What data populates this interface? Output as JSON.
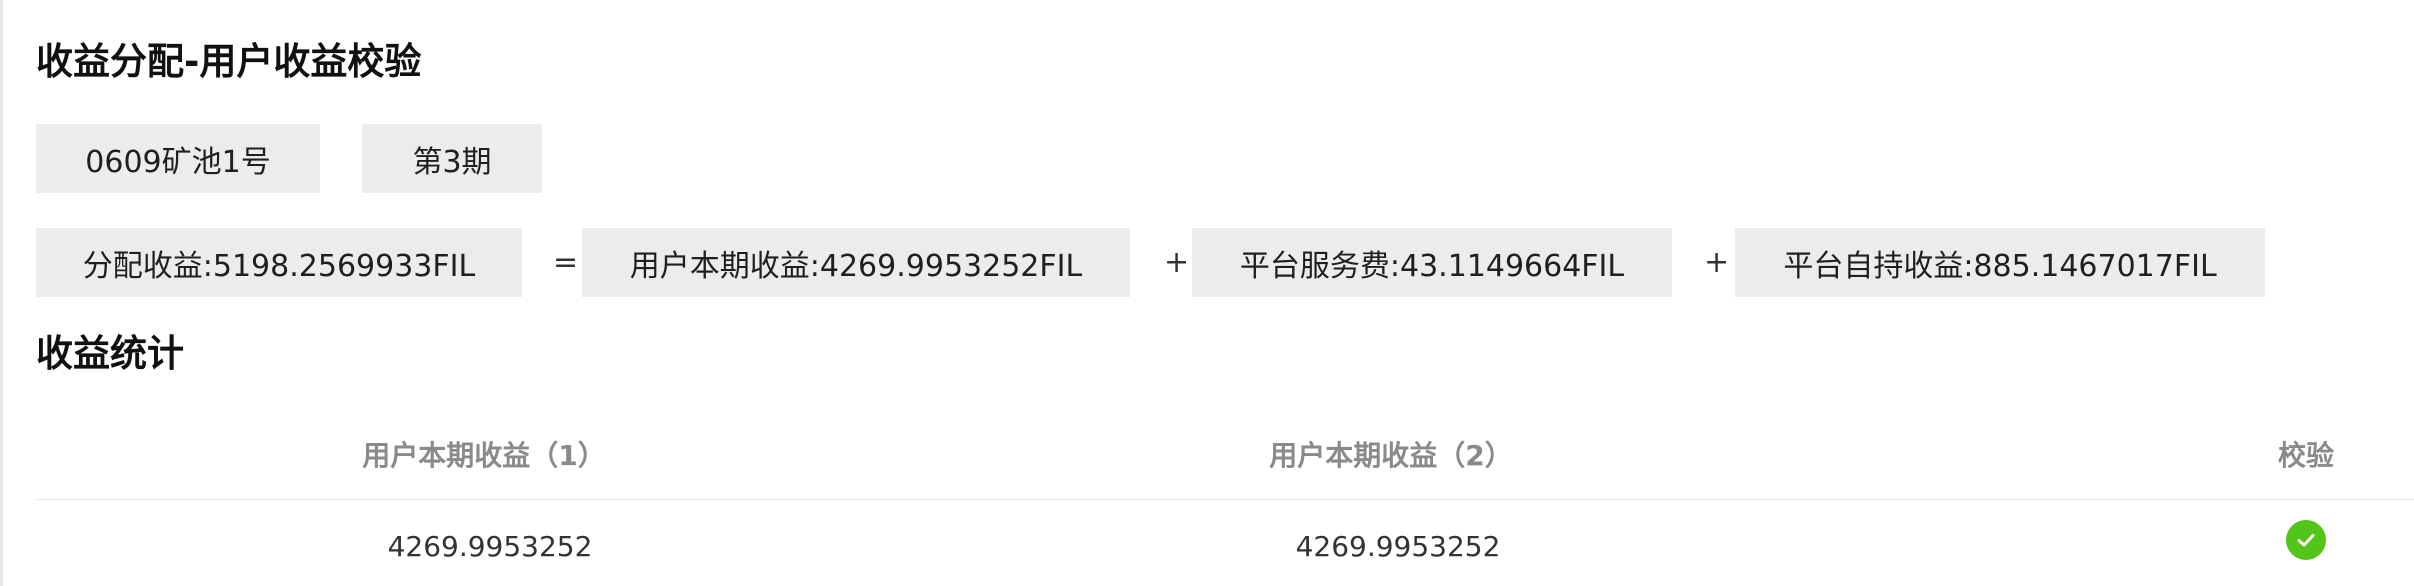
{
  "page_title": "收益分配-用户收益校验",
  "pool_chip": "0609矿池1号",
  "period_chip": "第3期",
  "formula": {
    "total": "分配收益:5198.2569933FIL",
    "equals": "=",
    "user_income": "用户本期收益:4269.9953252FIL",
    "plus_1": "+",
    "service_fee": "平台服务费:43.1149664FIL",
    "plus_2": "+",
    "self_held": "平台自持收益:885.1467017FIL"
  },
  "stats_title": "收益统计",
  "table": {
    "columns": [
      "用户本期收益（1）",
      "用户本期收益（2）",
      "校验"
    ],
    "rows": [
      {
        "income_1": "4269.9953252",
        "income_2": "4269.9953252",
        "verified": true
      }
    ]
  },
  "colors": {
    "chip_bg": "#ececec",
    "check_green": "#52c41a",
    "header_text": "#8a8a8a"
  },
  "icons": {
    "verify": "check-circle-icon"
  }
}
